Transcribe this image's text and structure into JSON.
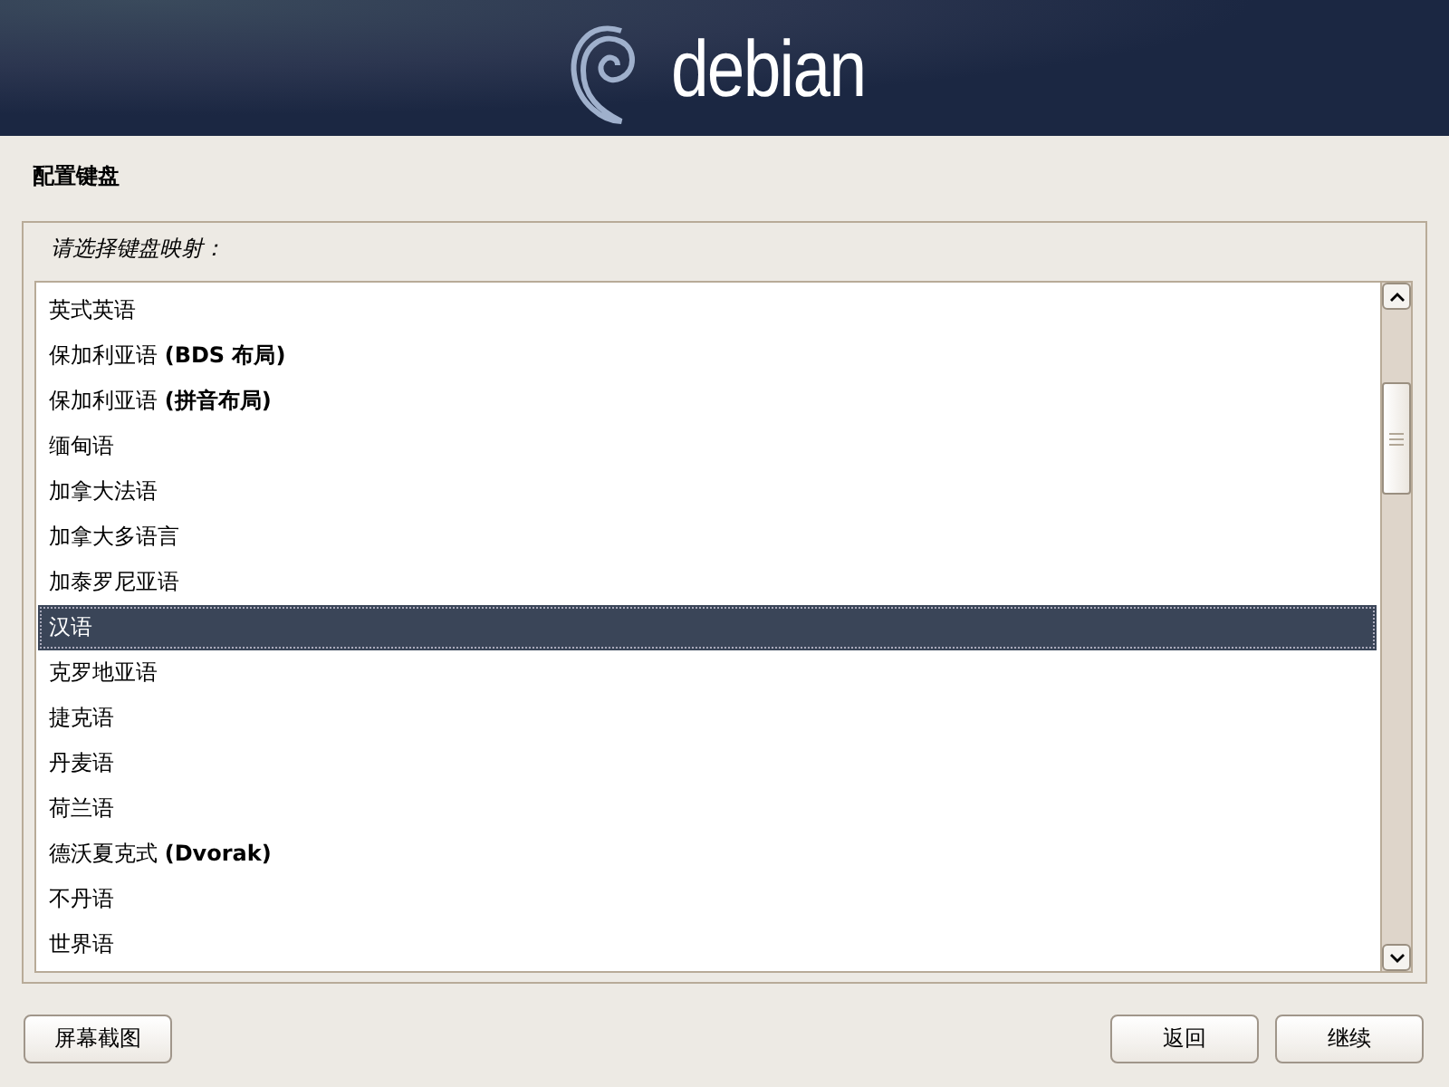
{
  "header": {
    "logo_text": "debian"
  },
  "page_title": "配置键盘",
  "prompt": "请选择键盘映射：",
  "keymaps": [
    {
      "label": "英式英语",
      "selected": false
    },
    {
      "label": "保加利亚语 **(BDS 布局)**",
      "selected": false
    },
    {
      "label": "保加利亚语 **(拼音布局)**",
      "selected": false
    },
    {
      "label": "缅甸语",
      "selected": false
    },
    {
      "label": "加拿大法语",
      "selected": false
    },
    {
      "label": "加拿大多语言",
      "selected": false
    },
    {
      "label": "加泰罗尼亚语",
      "selected": false
    },
    {
      "label": "汉语",
      "selected": true
    },
    {
      "label": "克罗地亚语",
      "selected": false
    },
    {
      "label": "捷克语",
      "selected": false
    },
    {
      "label": "丹麦语",
      "selected": false
    },
    {
      "label": "荷兰语",
      "selected": false
    },
    {
      "label": "德沃夏克式 **(Dvorak)**",
      "selected": false
    },
    {
      "label": "不丹语",
      "selected": false
    },
    {
      "label": "世界语",
      "selected": false
    }
  ],
  "buttons": {
    "left": [
      "屏幕截图"
    ],
    "right": [
      "返回",
      "继续"
    ]
  }
}
